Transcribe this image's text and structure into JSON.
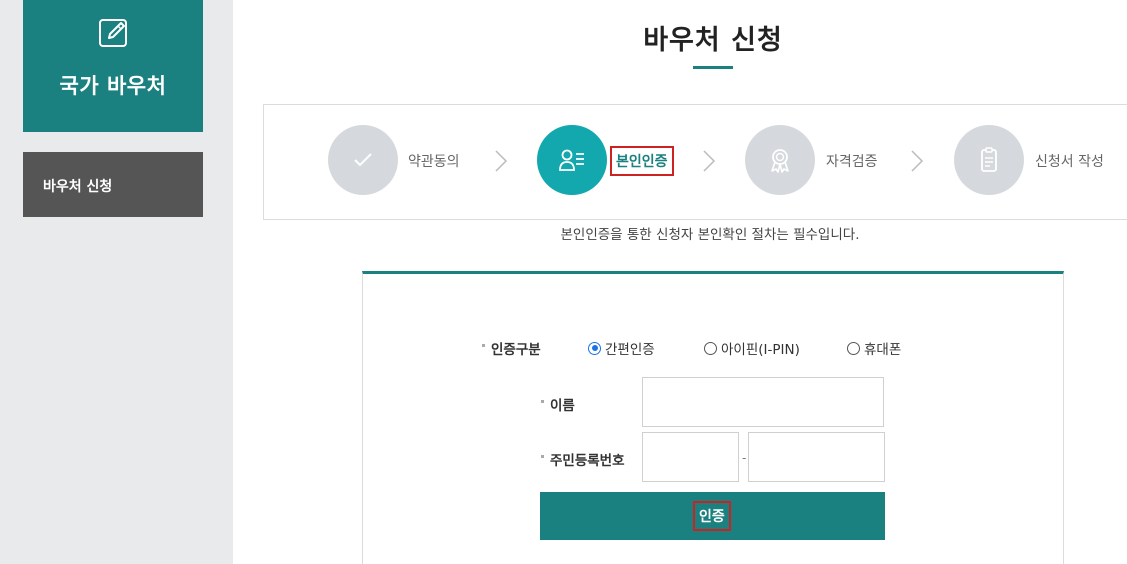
{
  "sidebar": {
    "header_title": "국가 바우처",
    "header_icon": "edit-icon",
    "menu_item": "바우처 신청"
  },
  "page": {
    "title": "바우처 신청"
  },
  "steps": [
    {
      "label": "약관동의",
      "icon": "check-icon",
      "active": false
    },
    {
      "label": "본인인증",
      "icon": "id-card-icon",
      "active": true
    },
    {
      "label": "자격검증",
      "icon": "award-icon",
      "active": false
    },
    {
      "label": "신청서 작성",
      "icon": "clipboard-icon",
      "active": false
    }
  ],
  "notice": "본인인증을 통한 신청자 본인확인 절차는 필수입니다.",
  "form": {
    "auth_type_label": "인증구분",
    "auth_options": [
      {
        "label": "간편인증",
        "selected": true
      },
      {
        "label": "아이핀(I-PIN)",
        "selected": false
      },
      {
        "label": "휴대폰",
        "selected": false
      }
    ],
    "name_label": "이름",
    "name_value": "",
    "rrn_label": "주민등록번호",
    "rrn_front_value": "",
    "rrn_back_value": "",
    "rrn_separator": "-",
    "submit_label": "인증"
  },
  "colors": {
    "primary": "#1a8080",
    "active_step": "#13a8ad",
    "inactive_step": "#d5d9dd",
    "highlight_border": "#cc2222",
    "sidebar_bg": "#e9eaec",
    "menu_bg": "#555555"
  }
}
